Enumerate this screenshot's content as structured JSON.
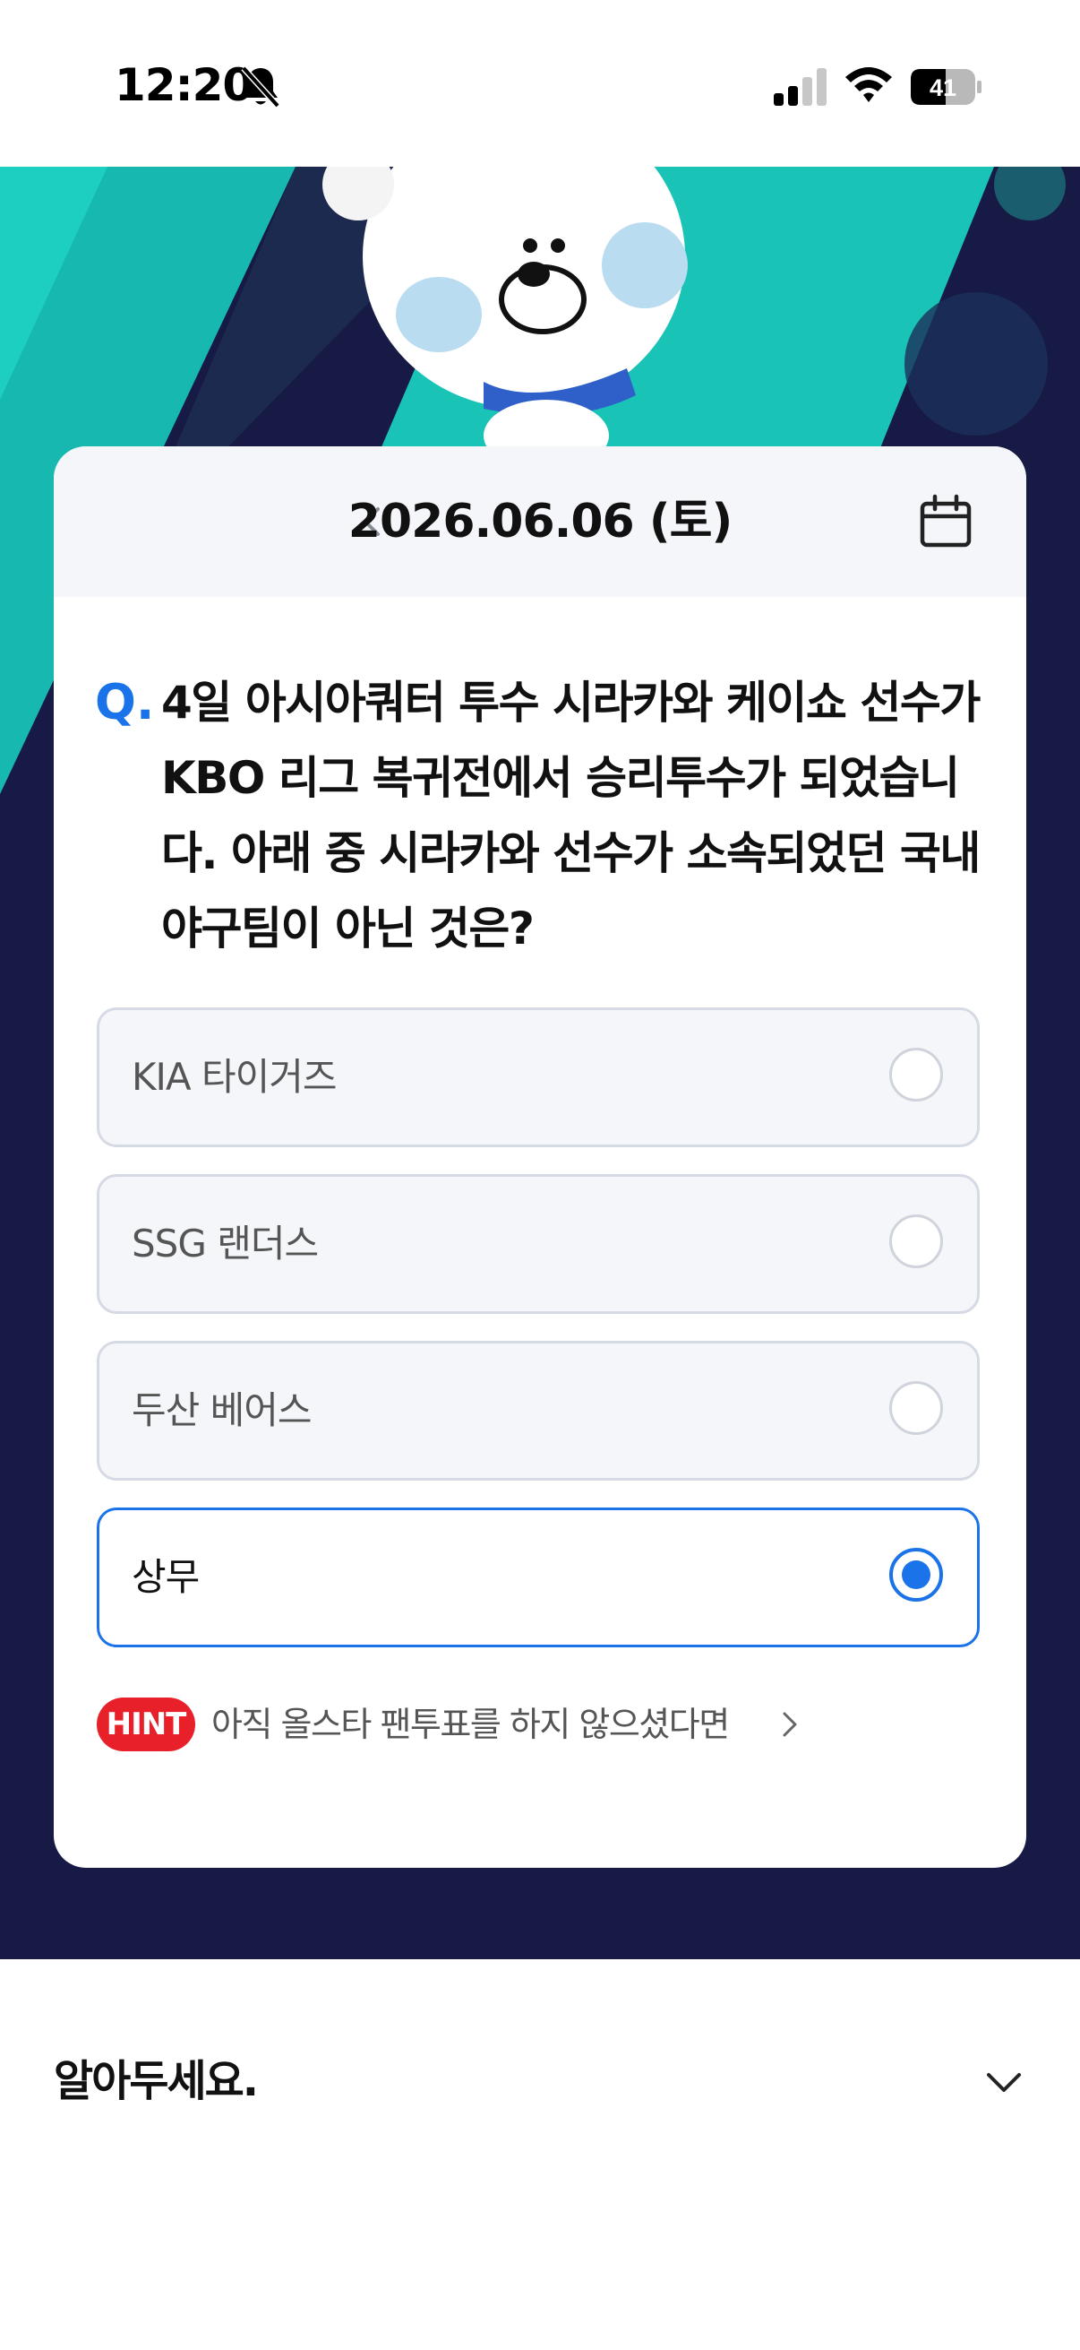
{
  "status": {
    "time": "12:20",
    "battery": "41",
    "bell_icon": "bell-slash-icon"
  },
  "header": {
    "date": "2026.06.06 (토)",
    "prev_icon": "chevron-left-icon",
    "calendar_icon": "calendar-icon"
  },
  "quiz": {
    "q_mark": "Q.",
    "question": "4일 아시아쿼터 투수 시라카와 케이쇼 선수가 KBO 리그 복귀전에서 승리투수가 되었습니다. 아래 중 시라카와 선수가 소속되었던 국내 야구팀이 아닌 것은?",
    "options": [
      {
        "label": "KIA 타이거즈",
        "selected": false
      },
      {
        "label": "SSG 랜더스",
        "selected": false
      },
      {
        "label": "두산 베어스",
        "selected": false
      },
      {
        "label": "상무",
        "selected": true
      }
    ]
  },
  "hint": {
    "badge": "HINT",
    "text": "아직 올스타 팬투표를 하지 않으셨다면"
  },
  "notice": {
    "title": "알아두세요.",
    "toggle_icon": "chevron-down-icon"
  },
  "colors": {
    "accent": "#1a73e8",
    "hint": "#e8202a",
    "hero_dark": "#171a44",
    "hero_teal": "#19c3b6"
  }
}
